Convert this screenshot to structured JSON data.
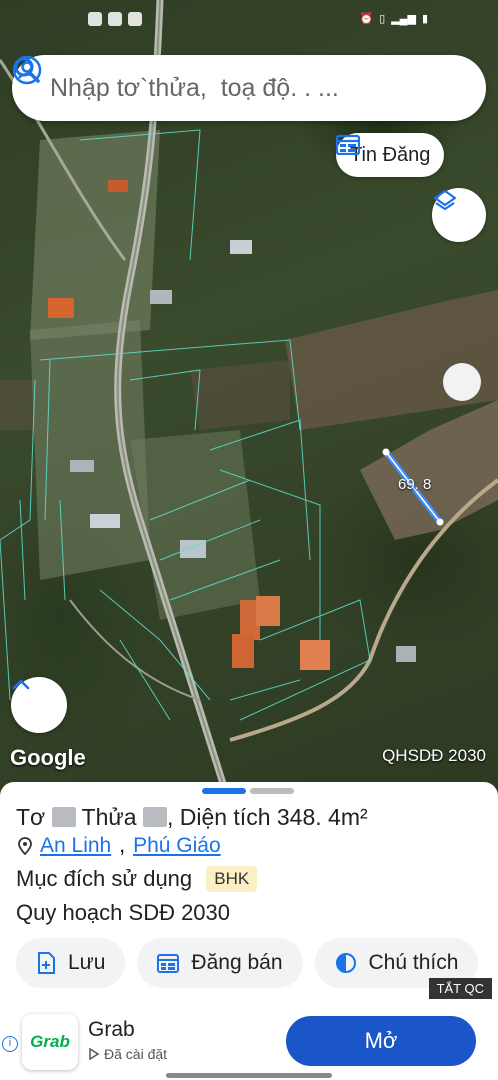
{
  "search": {
    "placeholder": "Nhập tơ`thửa,  toạ độ. . ..."
  },
  "map": {
    "tin_dang_label": "Tin Đăng",
    "measure_label": "69. 8",
    "google_label": "Google",
    "plan_label": "QHSDĐ 2030"
  },
  "sheet": {
    "title_prefix": "Tơ",
    "title_mid": "Thửa",
    "title_suffix": ",  Diện tích 348. 4m²",
    "place_1": "An Linh",
    "place_sep": ",",
    "place_2": "Phú Giáo",
    "purpose_label": "Mục đích sử dụng",
    "purpose_badge": "BHK",
    "plan_label": "Quy hoạch SDĐ 2030",
    "actions": [
      {
        "label": "Lưu",
        "icon": "add-doc-icon"
      },
      {
        "label": "Đăng bán",
        "icon": "calendar-icon"
      },
      {
        "label": "Chú thích",
        "icon": "half-circle-icon"
      }
    ],
    "ad_tag": "TẮT QC"
  },
  "ad": {
    "app_logo_text": "Grab",
    "app_name": "Grab",
    "installed_label": "Đã cài đặt",
    "open_label": "Mở"
  },
  "colors": {
    "accent": "#1a73e8",
    "open_button": "#1a56c8",
    "parcel_line": "#5fe0d0"
  }
}
